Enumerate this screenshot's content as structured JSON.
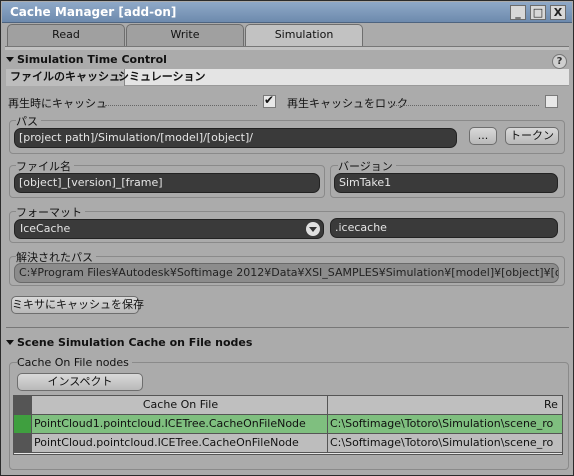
{
  "window": {
    "title": "Cache Manager [add-on]"
  },
  "titlebar_buttons": {
    "minimize": "_",
    "maximize": "□",
    "close": "X"
  },
  "tabs": [
    {
      "label": "Read"
    },
    {
      "label": "Write"
    },
    {
      "label": "Simulation"
    }
  ],
  "active_tab": "Simulation",
  "section1": {
    "title": "Simulation Time Control",
    "help": "?",
    "subtabs": [
      {
        "label": "ファイルのキャッシュ"
      },
      {
        "label": "シミュレーション"
      }
    ],
    "cache_on_play": {
      "label": "再生時にキャッシュ",
      "checked": true
    },
    "lock_cache": {
      "label": "再生キャッシュをロック",
      "checked": false
    },
    "path": {
      "label": "パス",
      "value": "[project path]/Simulation/[model]/[object]/",
      "browse": "...",
      "token_button": "トークン"
    },
    "filename": {
      "label": "ファイル名",
      "value": "[object]_[version]_[frame]"
    },
    "version": {
      "label": "バージョン",
      "value": "SimTake1"
    },
    "format": {
      "label": "フォーマット",
      "value": "IceCache",
      "extension": ".icecache"
    },
    "resolved_path": {
      "label": "解決されたパス",
      "value": "C:¥Program Files¥Autodesk¥Softimage 2012¥Data¥XSI_SAMPLES¥Simulation¥[model]¥[object]¥[object]_S"
    },
    "save_mixer_button": "ミキサにキャッシュを保存"
  },
  "section2": {
    "title": "Scene Simulation Cache on File nodes",
    "group_label": "Cache On File nodes",
    "inspect_button": "インスペクト",
    "table": {
      "columns": [
        "Cache On File",
        "Re"
      ],
      "rows": [
        {
          "node": "PointCloud1.pointcloud.ICETree.CacheOnFileNode",
          "path": "C:\\Softimage\\Totoro\\Simulation\\scene_ro",
          "selected": true
        },
        {
          "node": "PointCloud.pointcloud.ICETree.CacheOnFileNode",
          "path": "C:\\Softimage\\Totoro\\Simulation\\scene_ro",
          "selected": false
        }
      ]
    }
  },
  "colors": {
    "titlebar": "#7b97bb",
    "selected_row": "#7fbf7f",
    "field_bg": "#3a3a3a"
  }
}
